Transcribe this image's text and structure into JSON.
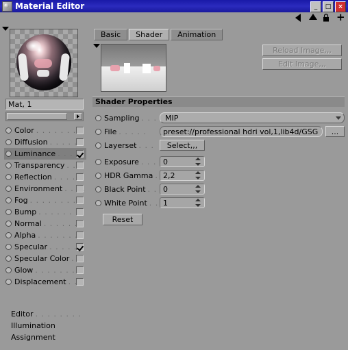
{
  "window": {
    "title": "Material Editor",
    "buttons": {
      "minimize": "_",
      "maximize": "□",
      "close": "×"
    }
  },
  "toolbar": {
    "icons": [
      "triangle-left-icon",
      "triangle-up-icon",
      "lock-icon",
      "plus-icon"
    ]
  },
  "left": {
    "material_name": "Mat, 1",
    "channels": [
      {
        "label": "Color",
        "checked": false,
        "selected": false
      },
      {
        "label": "Diffusion",
        "checked": false,
        "selected": false
      },
      {
        "label": "Luminance",
        "checked": true,
        "selected": true
      },
      {
        "label": "Transparency",
        "checked": false,
        "selected": false
      },
      {
        "label": "Reflection",
        "checked": false,
        "selected": false
      },
      {
        "label": "Environment",
        "checked": false,
        "selected": false
      },
      {
        "label": "Fog",
        "checked": false,
        "selected": false
      },
      {
        "label": "Bump",
        "checked": false,
        "selected": false
      },
      {
        "label": "Normal",
        "checked": false,
        "selected": false
      },
      {
        "label": "Alpha",
        "checked": false,
        "selected": false
      },
      {
        "label": "Specular",
        "checked": true,
        "selected": false
      },
      {
        "label": "Specular Color",
        "checked": false,
        "selected": false
      },
      {
        "label": "Glow",
        "checked": false,
        "selected": false
      },
      {
        "label": "Displacement",
        "checked": false,
        "selected": false
      }
    ],
    "sub_items": [
      {
        "label": "Editor",
        "dotted": true
      },
      {
        "label": "Illumination",
        "dotted": false
      },
      {
        "label": "Assignment",
        "dotted": false
      }
    ],
    "dots": ". . . . . . . . . . . . . . . . . . . ."
  },
  "right": {
    "tabs": [
      {
        "label": "Basic",
        "active": false
      },
      {
        "label": "Shader",
        "active": true
      },
      {
        "label": "Animation",
        "active": false
      }
    ],
    "image_buttons": [
      {
        "label": "Reload Image,,,",
        "enabled": false
      },
      {
        "label": "Edit Image,,,",
        "enabled": false
      }
    ],
    "section_title": "Shader Properties",
    "properties": [
      {
        "label": "Sampling",
        "dots": ". . .",
        "type": "combo",
        "value": "MIP"
      },
      {
        "label": "File",
        "dots": ". . . . .",
        "type": "file",
        "value": "preset://professional hdri vol,1,lib4d/GSG",
        "browse": "..."
      },
      {
        "label": "Layerset",
        "dots": ". . .",
        "type": "button",
        "value": "Select,,,"
      },
      {
        "label": "Exposure",
        "dots": ". . .",
        "type": "number",
        "value": "0"
      },
      {
        "label": "HDR Gamma",
        "dots": ". .",
        "type": "number",
        "value": "2,2"
      },
      {
        "label": "Black Point",
        "dots": ". .",
        "type": "number",
        "value": "0"
      },
      {
        "label": "White Point",
        "dots": ". .",
        "type": "number",
        "value": "1"
      }
    ],
    "reset_label": "Reset"
  }
}
